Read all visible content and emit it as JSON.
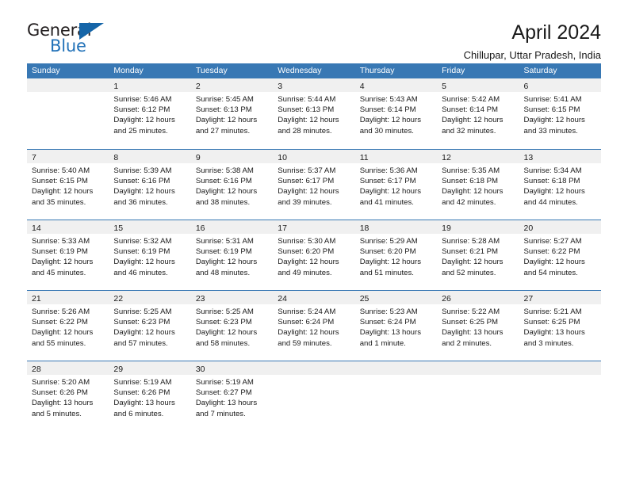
{
  "brand": {
    "name_part1": "General",
    "name_part2": "Blue",
    "flag_icon": "triangle-flag-icon"
  },
  "header": {
    "title": "April 2024",
    "subtitle": "Chillupar, Uttar Pradesh, India"
  },
  "colors": {
    "header_blue": "#3878b4",
    "brand_blue": "#2272b8",
    "day_band_gray": "#f0f0f0",
    "text": "#1a1a1a"
  },
  "weekdays": [
    "Sunday",
    "Monday",
    "Tuesday",
    "Wednesday",
    "Thursday",
    "Friday",
    "Saturday"
  ],
  "weeks": [
    [
      {
        "day": "",
        "lines": []
      },
      {
        "day": "1",
        "lines": [
          "Sunrise: 5:46 AM",
          "Sunset: 6:12 PM",
          "Daylight: 12 hours",
          "and 25 minutes."
        ]
      },
      {
        "day": "2",
        "lines": [
          "Sunrise: 5:45 AM",
          "Sunset: 6:13 PM",
          "Daylight: 12 hours",
          "and 27 minutes."
        ]
      },
      {
        "day": "3",
        "lines": [
          "Sunrise: 5:44 AM",
          "Sunset: 6:13 PM",
          "Daylight: 12 hours",
          "and 28 minutes."
        ]
      },
      {
        "day": "4",
        "lines": [
          "Sunrise: 5:43 AM",
          "Sunset: 6:14 PM",
          "Daylight: 12 hours",
          "and 30 minutes."
        ]
      },
      {
        "day": "5",
        "lines": [
          "Sunrise: 5:42 AM",
          "Sunset: 6:14 PM",
          "Daylight: 12 hours",
          "and 32 minutes."
        ]
      },
      {
        "day": "6",
        "lines": [
          "Sunrise: 5:41 AM",
          "Sunset: 6:15 PM",
          "Daylight: 12 hours",
          "and 33 minutes."
        ]
      }
    ],
    [
      {
        "day": "7",
        "lines": [
          "Sunrise: 5:40 AM",
          "Sunset: 6:15 PM",
          "Daylight: 12 hours",
          "and 35 minutes."
        ]
      },
      {
        "day": "8",
        "lines": [
          "Sunrise: 5:39 AM",
          "Sunset: 6:16 PM",
          "Daylight: 12 hours",
          "and 36 minutes."
        ]
      },
      {
        "day": "9",
        "lines": [
          "Sunrise: 5:38 AM",
          "Sunset: 6:16 PM",
          "Daylight: 12 hours",
          "and 38 minutes."
        ]
      },
      {
        "day": "10",
        "lines": [
          "Sunrise: 5:37 AM",
          "Sunset: 6:17 PM",
          "Daylight: 12 hours",
          "and 39 minutes."
        ]
      },
      {
        "day": "11",
        "lines": [
          "Sunrise: 5:36 AM",
          "Sunset: 6:17 PM",
          "Daylight: 12 hours",
          "and 41 minutes."
        ]
      },
      {
        "day": "12",
        "lines": [
          "Sunrise: 5:35 AM",
          "Sunset: 6:18 PM",
          "Daylight: 12 hours",
          "and 42 minutes."
        ]
      },
      {
        "day": "13",
        "lines": [
          "Sunrise: 5:34 AM",
          "Sunset: 6:18 PM",
          "Daylight: 12 hours",
          "and 44 minutes."
        ]
      }
    ],
    [
      {
        "day": "14",
        "lines": [
          "Sunrise: 5:33 AM",
          "Sunset: 6:19 PM",
          "Daylight: 12 hours",
          "and 45 minutes."
        ]
      },
      {
        "day": "15",
        "lines": [
          "Sunrise: 5:32 AM",
          "Sunset: 6:19 PM",
          "Daylight: 12 hours",
          "and 46 minutes."
        ]
      },
      {
        "day": "16",
        "lines": [
          "Sunrise: 5:31 AM",
          "Sunset: 6:19 PM",
          "Daylight: 12 hours",
          "and 48 minutes."
        ]
      },
      {
        "day": "17",
        "lines": [
          "Sunrise: 5:30 AM",
          "Sunset: 6:20 PM",
          "Daylight: 12 hours",
          "and 49 minutes."
        ]
      },
      {
        "day": "18",
        "lines": [
          "Sunrise: 5:29 AM",
          "Sunset: 6:20 PM",
          "Daylight: 12 hours",
          "and 51 minutes."
        ]
      },
      {
        "day": "19",
        "lines": [
          "Sunrise: 5:28 AM",
          "Sunset: 6:21 PM",
          "Daylight: 12 hours",
          "and 52 minutes."
        ]
      },
      {
        "day": "20",
        "lines": [
          "Sunrise: 5:27 AM",
          "Sunset: 6:22 PM",
          "Daylight: 12 hours",
          "and 54 minutes."
        ]
      }
    ],
    [
      {
        "day": "21",
        "lines": [
          "Sunrise: 5:26 AM",
          "Sunset: 6:22 PM",
          "Daylight: 12 hours",
          "and 55 minutes."
        ]
      },
      {
        "day": "22",
        "lines": [
          "Sunrise: 5:25 AM",
          "Sunset: 6:23 PM",
          "Daylight: 12 hours",
          "and 57 minutes."
        ]
      },
      {
        "day": "23",
        "lines": [
          "Sunrise: 5:25 AM",
          "Sunset: 6:23 PM",
          "Daylight: 12 hours",
          "and 58 minutes."
        ]
      },
      {
        "day": "24",
        "lines": [
          "Sunrise: 5:24 AM",
          "Sunset: 6:24 PM",
          "Daylight: 12 hours",
          "and 59 minutes."
        ]
      },
      {
        "day": "25",
        "lines": [
          "Sunrise: 5:23 AM",
          "Sunset: 6:24 PM",
          "Daylight: 13 hours",
          "and 1 minute."
        ]
      },
      {
        "day": "26",
        "lines": [
          "Sunrise: 5:22 AM",
          "Sunset: 6:25 PM",
          "Daylight: 13 hours",
          "and 2 minutes."
        ]
      },
      {
        "day": "27",
        "lines": [
          "Sunrise: 5:21 AM",
          "Sunset: 6:25 PM",
          "Daylight: 13 hours",
          "and 3 minutes."
        ]
      }
    ],
    [
      {
        "day": "28",
        "lines": [
          "Sunrise: 5:20 AM",
          "Sunset: 6:26 PM",
          "Daylight: 13 hours",
          "and 5 minutes."
        ]
      },
      {
        "day": "29",
        "lines": [
          "Sunrise: 5:19 AM",
          "Sunset: 6:26 PM",
          "Daylight: 13 hours",
          "and 6 minutes."
        ]
      },
      {
        "day": "30",
        "lines": [
          "Sunrise: 5:19 AM",
          "Sunset: 6:27 PM",
          "Daylight: 13 hours",
          "and 7 minutes."
        ]
      },
      {
        "day": "",
        "lines": []
      },
      {
        "day": "",
        "lines": []
      },
      {
        "day": "",
        "lines": []
      },
      {
        "day": "",
        "lines": []
      }
    ]
  ]
}
